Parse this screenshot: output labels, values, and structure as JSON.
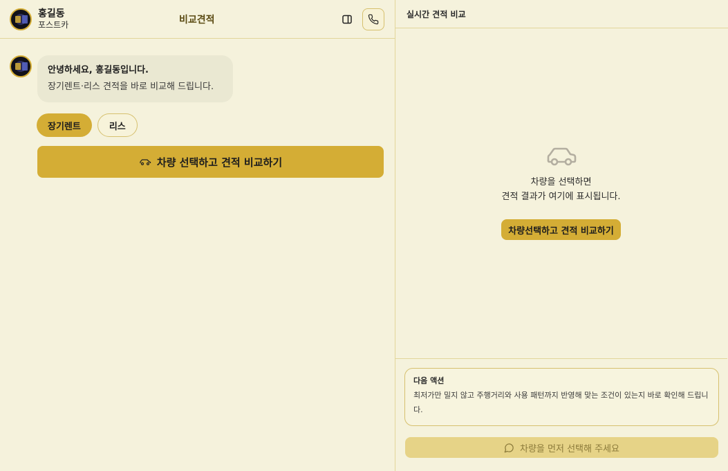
{
  "left": {
    "agent": {
      "name": "홍길동",
      "company": "포스트카"
    },
    "title": "비교견적",
    "greeting": {
      "title": "안녕하세요, 홍길동입니다.",
      "subtitle": "장기렌트·리스 견적을 바로 비교해 드립니다."
    },
    "chips": [
      {
        "label": "장기렌트",
        "active": true
      },
      {
        "label": "리스",
        "active": false
      }
    ],
    "cta_label": "차량 선택하고 견적 비교하기"
  },
  "right": {
    "title": "실시간 견적 비교",
    "empty": {
      "line1": "차량을 선택하면",
      "line2": "견적 결과가 여기에 표시됩니다.",
      "cta_label": "차량선택하고 견적 비교하기"
    },
    "next_action": {
      "title": "다음 액션",
      "body": "최저가만 밀지 않고 주행거리와 사용 패턴까지 반영해 맞는 조건이 있는지 바로 확인해 드립니다."
    },
    "disabled_button_label": "차량을 먼저 선택해 주세요"
  },
  "icons": {
    "panel_toggle": "sidebar-toggle-icon",
    "phone": "phone-icon",
    "car": "car-icon",
    "chat": "chat-bubble-icon"
  },
  "colors": {
    "background": "#f5f2dc",
    "accent": "#d4ad35",
    "border": "#e2d69a",
    "bubble": "#eae8d2"
  }
}
